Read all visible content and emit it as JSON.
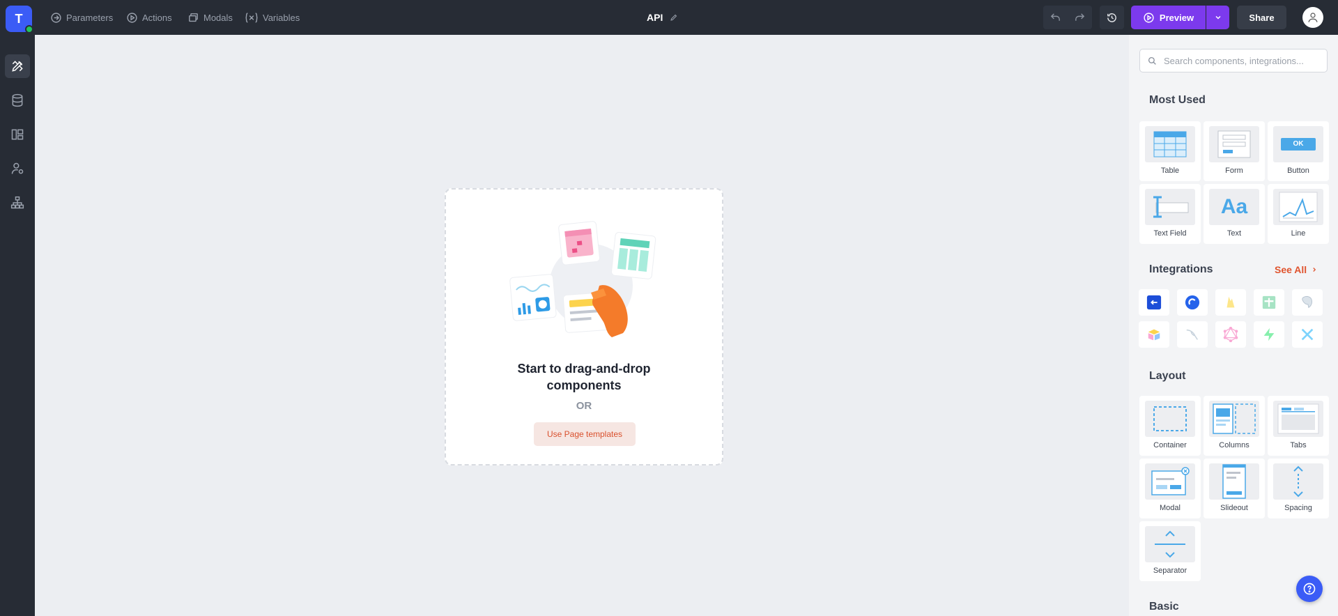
{
  "app": {
    "logo_letter": "T",
    "page_title": "API"
  },
  "topnav": [
    {
      "label": "Parameters",
      "icon": "arrow-right-circle-icon"
    },
    {
      "label": "Actions",
      "icon": "play-circle-icon"
    },
    {
      "label": "Modals",
      "icon": "window-stack-icon"
    },
    {
      "label": "Variables",
      "icon": "variable-x-icon"
    }
  ],
  "toolbar": {
    "preview_label": "Preview",
    "share_label": "Share"
  },
  "sidebar": [
    {
      "icon": "design-tools-icon",
      "active": true
    },
    {
      "icon": "database-icon"
    },
    {
      "icon": "layout-grid-icon"
    },
    {
      "icon": "user-settings-icon"
    },
    {
      "icon": "sitemap-icon"
    }
  ],
  "canvas": {
    "title": "Start to drag-and-drop components",
    "or": "OR",
    "templates_button": "Use Page templates"
  },
  "panel": {
    "search_placeholder": "Search components, integrations...",
    "most_used": {
      "title": "Most Used",
      "items": [
        "Table",
        "Form",
        "Button",
        "Text Field",
        "Text",
        "Line"
      ]
    },
    "button_thumb_text": "OK",
    "text_thumb_text": "Aa",
    "integrations": {
      "title": "Integrations",
      "see_all": "See All",
      "items": [
        "api-icon",
        "openai-icon",
        "firebase-icon",
        "google-sheets-icon",
        "postgresql-icon",
        "airtable-icon",
        "mysql-icon",
        "graphql-icon",
        "supabase-icon",
        "airtable-x-icon"
      ]
    },
    "layout": {
      "title": "Layout",
      "items": [
        "Container",
        "Columns",
        "Tabs",
        "Modal",
        "Slideout",
        "Spacing",
        "Separator"
      ]
    },
    "basic": {
      "title": "Basic"
    }
  },
  "colors": {
    "accent": "#7c3aed",
    "brand": "#3b5cf6",
    "link": "#e0542e",
    "topbar": "#272c35"
  }
}
